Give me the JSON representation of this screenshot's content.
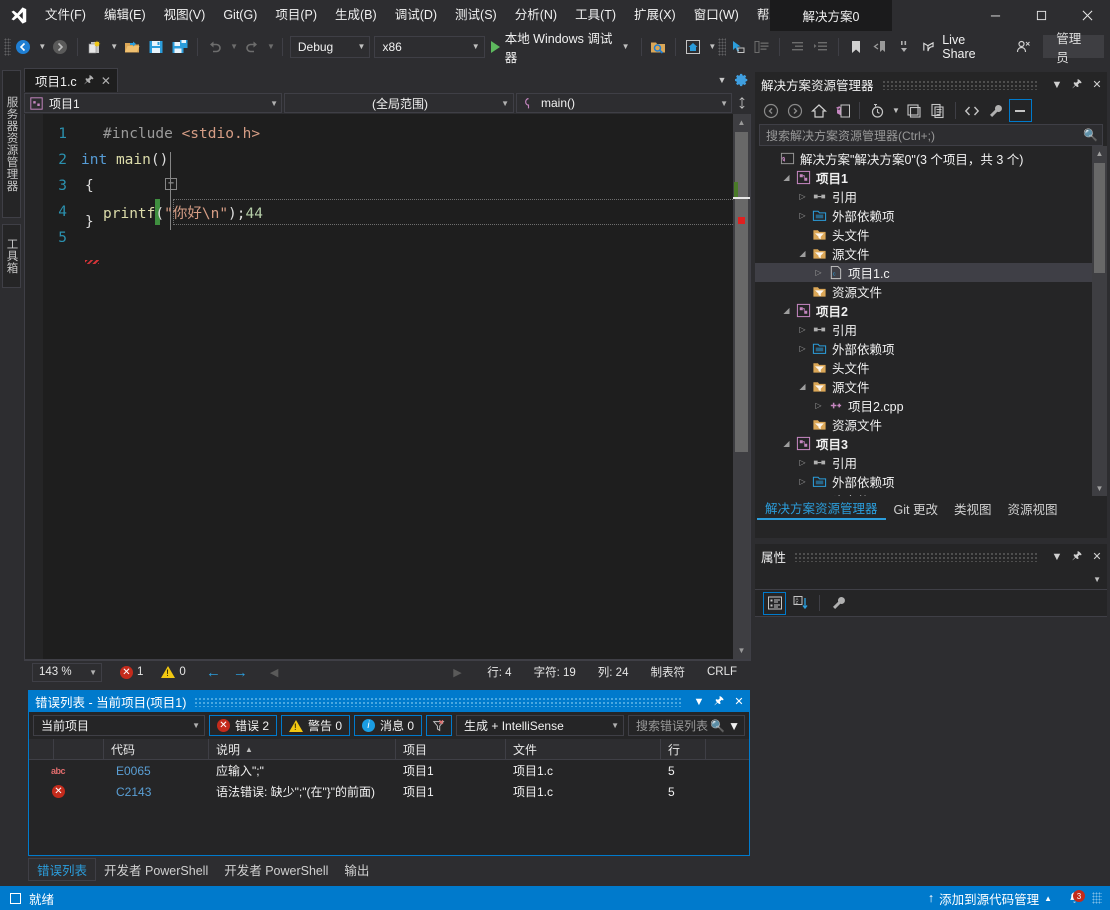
{
  "app": {
    "solution_name": "解决方案0",
    "admin_label": "管理员",
    "live_share": "Live Share"
  },
  "menu": {
    "items": [
      {
        "label": "文件(F)"
      },
      {
        "label": "编辑(E)"
      },
      {
        "label": "视图(V)"
      },
      {
        "label": "Git(G)"
      },
      {
        "label": "项目(P)"
      },
      {
        "label": "生成(B)"
      },
      {
        "label": "调试(D)"
      },
      {
        "label": "测试(S)"
      },
      {
        "label": "分析(N)"
      },
      {
        "label": "工具(T)"
      },
      {
        "label": "扩展(X)"
      },
      {
        "label": "窗口(W)"
      },
      {
        "label": "帮助(H)"
      }
    ],
    "quick_launch_dots": "..."
  },
  "toolbar": {
    "config": "Debug",
    "platform": "x86",
    "run_label": "本地 Windows 调试器"
  },
  "left_rail": {
    "tabs": [
      {
        "label": "服务器资源管理器"
      },
      {
        "label": "工具箱"
      }
    ]
  },
  "editor": {
    "tab_label": "项目1.c",
    "nav": {
      "project": "项目1",
      "scope": "(全局范围)",
      "member": "main()"
    },
    "lines": [
      {
        "num": "1",
        "text": "#include <stdio.h>"
      },
      {
        "num": "2",
        "text": "int main()"
      },
      {
        "num": "3",
        "text": "{"
      },
      {
        "num": "4",
        "text": "    printf(\"你好\\n\");44"
      },
      {
        "num": "5",
        "text": "}"
      }
    ],
    "status": {
      "zoom": "143 %",
      "error_count": "1",
      "warning_count": "0",
      "line": "行: 4",
      "char": "字符: 19",
      "col": "列: 24",
      "tabs_mode": "制表符",
      "eol": "CRLF"
    }
  },
  "solution_explorer": {
    "title": "解决方案资源管理器",
    "search_placeholder": "搜索解决方案资源管理器(Ctrl+;)",
    "tree": [
      {
        "label": "解决方案\"解决方案0\"(3 个项目，共 3 个)",
        "depth": 0,
        "twisty": "",
        "icon": "solution",
        "selected": false
      },
      {
        "label": "项目1",
        "depth": 1,
        "twisty": "open",
        "icon": "project-c",
        "selected": false,
        "bold": true
      },
      {
        "label": "引用",
        "depth": 2,
        "twisty": "closed",
        "icon": "references",
        "selected": false
      },
      {
        "label": "外部依赖项",
        "depth": 2,
        "twisty": "closed",
        "icon": "folder-blue",
        "selected": false
      },
      {
        "label": "头文件",
        "depth": 2,
        "twisty": "",
        "icon": "folder-filter",
        "selected": false
      },
      {
        "label": "源文件",
        "depth": 2,
        "twisty": "open",
        "icon": "folder-filter",
        "selected": false
      },
      {
        "label": "项目1.c",
        "depth": 3,
        "twisty": "closed",
        "icon": "file-c",
        "selected": true
      },
      {
        "label": "资源文件",
        "depth": 2,
        "twisty": "",
        "icon": "folder-filter",
        "selected": false
      },
      {
        "label": "项目2",
        "depth": 1,
        "twisty": "open",
        "icon": "project-c",
        "selected": false,
        "bold": true
      },
      {
        "label": "引用",
        "depth": 2,
        "twisty": "closed",
        "icon": "references",
        "selected": false
      },
      {
        "label": "外部依赖项",
        "depth": 2,
        "twisty": "closed",
        "icon": "folder-blue",
        "selected": false
      },
      {
        "label": "头文件",
        "depth": 2,
        "twisty": "",
        "icon": "folder-filter",
        "selected": false
      },
      {
        "label": "源文件",
        "depth": 2,
        "twisty": "open",
        "icon": "folder-filter",
        "selected": false
      },
      {
        "label": "项目2.cpp",
        "depth": 3,
        "twisty": "closed",
        "icon": "file-cpp",
        "selected": false
      },
      {
        "label": "资源文件",
        "depth": 2,
        "twisty": "",
        "icon": "folder-filter",
        "selected": false
      },
      {
        "label": "项目3",
        "depth": 1,
        "twisty": "open",
        "icon": "project-c",
        "selected": false,
        "bold": true
      },
      {
        "label": "引用",
        "depth": 2,
        "twisty": "closed",
        "icon": "references",
        "selected": false
      },
      {
        "label": "外部依赖项",
        "depth": 2,
        "twisty": "closed",
        "icon": "folder-blue",
        "selected": false
      },
      {
        "label": "头文件",
        "depth": 2,
        "twisty": "open",
        "icon": "folder-filter",
        "selected": false
      }
    ],
    "tabs": [
      {
        "label": "解决方案资源管理器",
        "active": true
      },
      {
        "label": "Git 更改",
        "active": false
      },
      {
        "label": "类视图",
        "active": false
      },
      {
        "label": "资源视图",
        "active": false
      }
    ]
  },
  "properties": {
    "title": "属性"
  },
  "error_list": {
    "title": "错误列表 - 当前项目(项目1)",
    "scope": "当前项目",
    "errors_chip": "错误 2",
    "warnings_chip": "警告 0",
    "messages_chip": "消息 0",
    "source_filter": "生成 + IntelliSense",
    "search_placeholder": "搜索错误列表",
    "columns": [
      "代码",
      "说明",
      "项目",
      "文件",
      "行"
    ],
    "sort_indicator": "▲",
    "rows": [
      {
        "icon": "intellisense",
        "code": "E0065",
        "desc": "应输入\";\"",
        "project": "项目1",
        "file": "项目1.c",
        "line": "5"
      },
      {
        "icon": "error",
        "code": "C2143",
        "desc": "语法错误: 缺少\";\"(在\"}\"的前面)",
        "project": "项目1",
        "file": "项目1.c",
        "line": "5"
      }
    ]
  },
  "bottom_tabs": [
    {
      "label": "错误列表",
      "active": true
    },
    {
      "label": "开发者 PowerShell",
      "active": false
    },
    {
      "label": "开发者 PowerShell",
      "active": false
    },
    {
      "label": "输出",
      "active": false
    }
  ],
  "statusbar": {
    "ready": "就绪",
    "source_control": "添加到源代码管理",
    "notification_count": "3"
  },
  "colors": {
    "accent": "#007acc",
    "error": "#c42b1c",
    "warning": "#f2c811",
    "info": "#1b9de2",
    "background": "#2d2d30",
    "editor_bg": "#1e1e1e"
  }
}
